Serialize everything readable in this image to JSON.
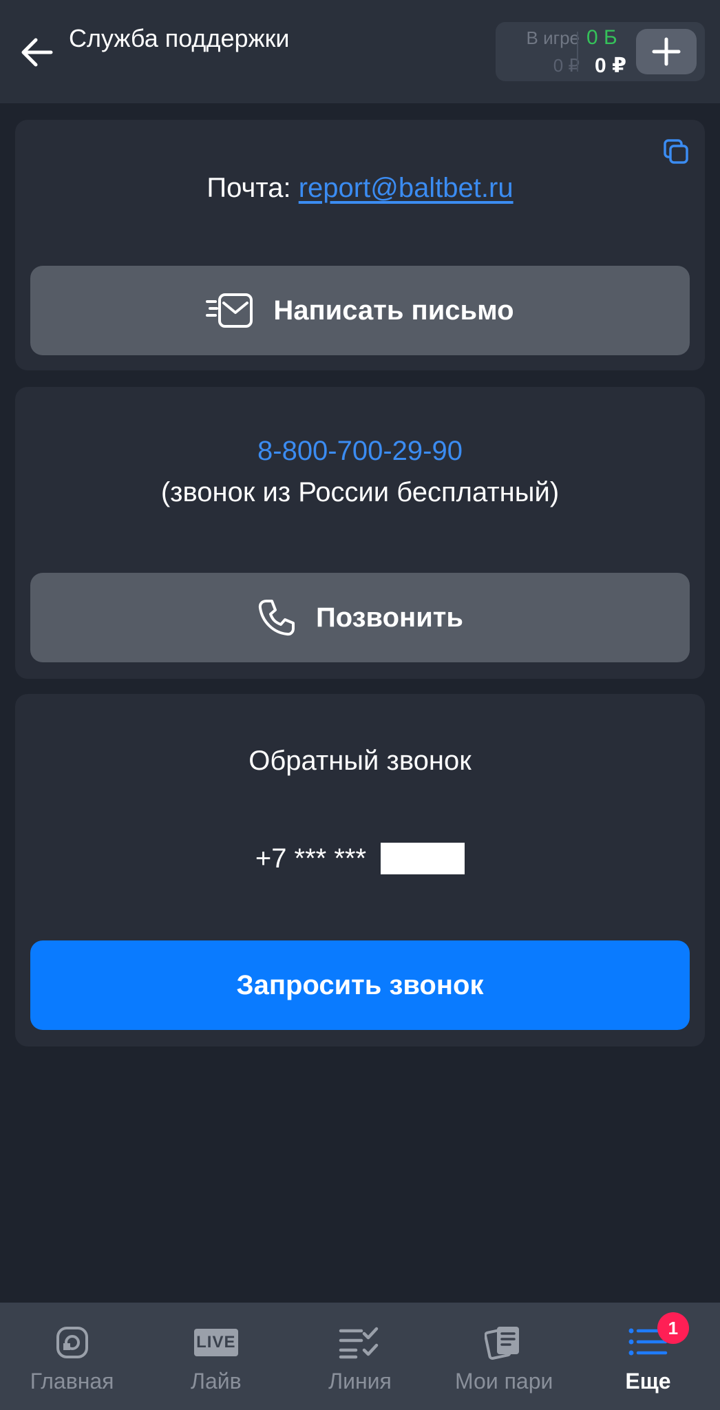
{
  "header": {
    "title": "Служба поддержки",
    "balance": {
      "in_game_label": "В игре",
      "in_game_value": "0 ₽",
      "bonus_value": "0 Б",
      "money_value": "0 ₽"
    }
  },
  "email_card": {
    "prefix": "Почта: ",
    "email": "report@baltbet.ru",
    "button_label": "Написать письмо"
  },
  "phone_card": {
    "number": "8-800-700-29-90",
    "note": "(звонок из России бесплатный)",
    "button_label": "Позвонить"
  },
  "callback_card": {
    "title": "Обратный звонок",
    "masked_phone": "+7 *** *** ",
    "button_label": "Запросить звонок"
  },
  "bottom_nav": {
    "items": [
      {
        "label": "Главная",
        "icon": "home-icon"
      },
      {
        "label": "Лайв",
        "icon": "live-icon",
        "icon_text": "LIVE"
      },
      {
        "label": "Линия",
        "icon": "line-list-icon"
      },
      {
        "label": "Мои пари",
        "icon": "my-bets-icon"
      },
      {
        "label": "Еще",
        "icon": "more-menu-icon",
        "badge": "1",
        "active": true
      }
    ]
  },
  "colors": {
    "background": "#1e232d",
    "card": "#282d38",
    "accent_blue": "#0a7bff",
    "link_blue": "#3b8cf2",
    "bonus_green": "#35c25a",
    "badge_red": "#ff1f55"
  }
}
